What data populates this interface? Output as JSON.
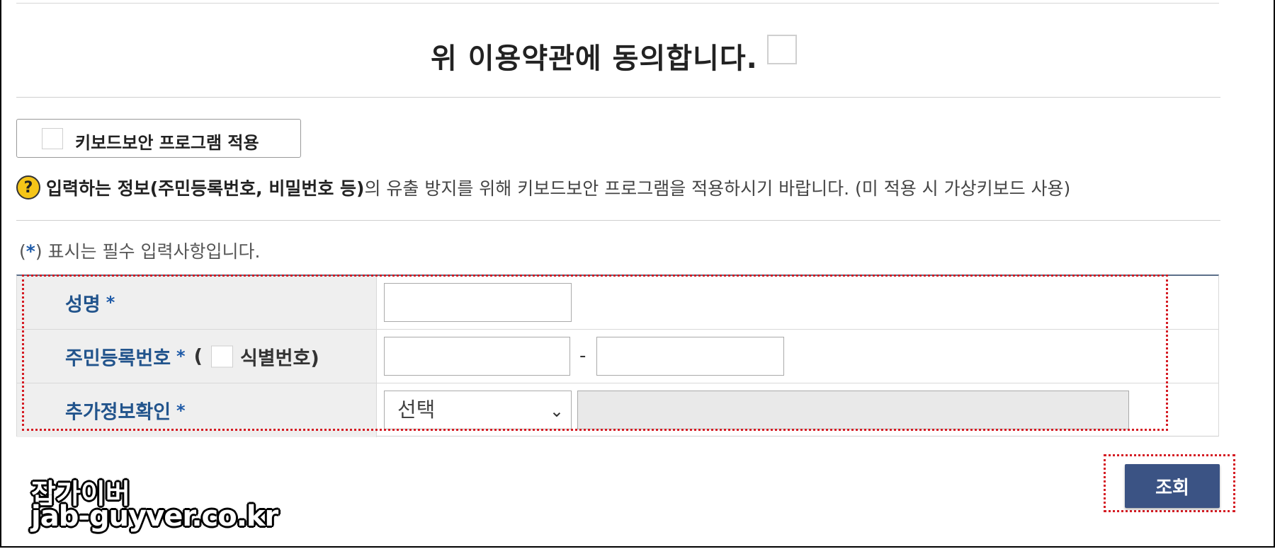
{
  "agreement": {
    "title": "위 이용약관에 동의합니다."
  },
  "keyboard_security": {
    "label": "키보드보안 프로그램 적용"
  },
  "notice": {
    "icon": "question-icon",
    "icon_glyph": "?",
    "strong_text": "입력하는 정보(주민등록번호, 비밀번호 등)",
    "text": "의 유출 방지를 위해 키보드보안 프로그램을 적용하시기 바랍니다. (미 적용 시 가상키보드 사용)"
  },
  "required_note": {
    "open": "(",
    "star": "*",
    "text": ") 표시는 필수 입력사항입니다."
  },
  "form": {
    "name_label": "성명",
    "rrn_label": "주민등록번호",
    "rrn_paren_open": "(",
    "rrn_paren_text": "식별번호)",
    "rrn_separator": "-",
    "extra_label": "추가정보확인",
    "extra_select_value": "선택",
    "required_star": "*"
  },
  "actions": {
    "search_label": "조회"
  },
  "watermark": {
    "line1": "잡가이버",
    "line2": "jab-guyver.co.kr"
  },
  "colors": {
    "label_blue": "#22548c",
    "button_blue": "#3b5384",
    "highlight_red": "#d51c24",
    "help_yellow": "#f5c518"
  }
}
